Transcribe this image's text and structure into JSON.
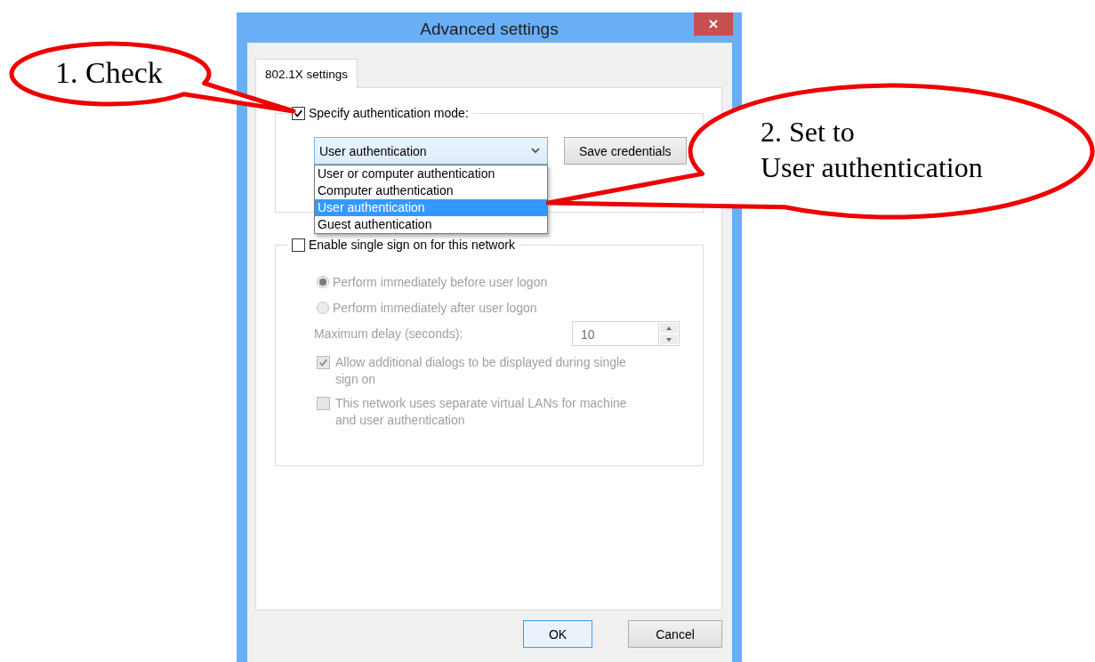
{
  "dialog": {
    "title": "Advanced settings",
    "tabs": [
      {
        "label": "802.1X settings",
        "selected": true
      }
    ],
    "auth_mode": {
      "label": "Specify authentication mode:",
      "checked": true,
      "dropdown": {
        "value": "User authentication",
        "expanded": true,
        "options": [
          {
            "label": "User or computer authentication",
            "selected": false
          },
          {
            "label": "Computer authentication",
            "selected": false
          },
          {
            "label": "User authentication",
            "selected": true
          },
          {
            "label": "Guest authentication",
            "selected": false
          }
        ]
      },
      "save_button": "Save credentials"
    },
    "single_sign_on": {
      "label": "Enable single sign on for this network",
      "checked": false,
      "options": [
        {
          "kind": "radio",
          "label": "Perform immediately before user logon",
          "selected": true,
          "disabled": true
        },
        {
          "kind": "radio",
          "label": "Perform immediately after user logon",
          "selected": false,
          "disabled": true
        },
        {
          "kind": "spinner",
          "label": "Maximum delay (seconds):",
          "value": "10",
          "disabled": true
        },
        {
          "kind": "checkbox",
          "label": "Allow additional dialogs to be displayed during single sign on",
          "checked": true,
          "disabled": true
        },
        {
          "kind": "checkbox",
          "label": "This network uses separate virtual LANs for machine and user authentication",
          "checked": false,
          "disabled": true
        }
      ]
    },
    "buttons": [
      {
        "label": "OK",
        "default": true
      },
      {
        "label": "Cancel",
        "default": false
      }
    ]
  },
  "callouts": [
    {
      "lines": [
        "1. Check"
      ]
    },
    {
      "lines": [
        "2. Set to",
        "User authentication"
      ]
    }
  ]
}
